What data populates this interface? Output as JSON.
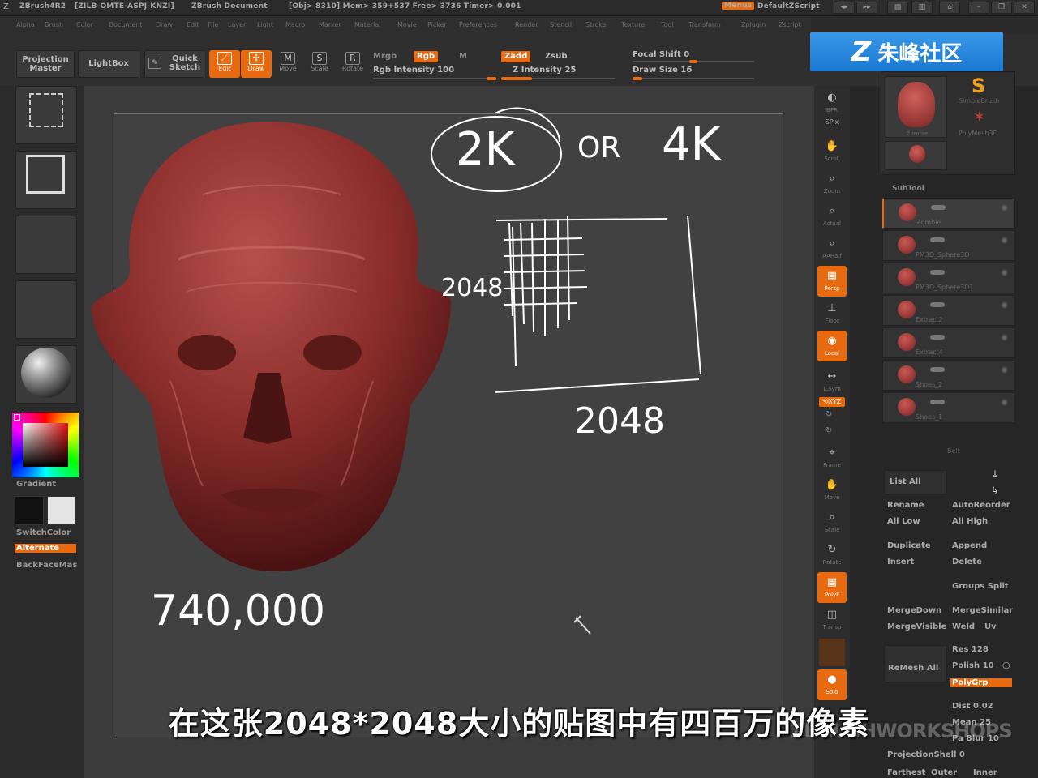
{
  "titlebar": {
    "app": "ZBrush4R2",
    "build": "[ZILB-OMTE-ASPJ-KNZI]",
    "doc": "ZBrush Document",
    "stats": "[Obj> 8310] Mem> 359+537  Free> 3736  Timer> 0.001",
    "menus_btn": "Menus",
    "script": "DefaultZScript"
  },
  "menubar": [
    "Alpha",
    "Brush",
    "Color",
    "Document",
    "Draw",
    "Edit",
    "File",
    "Layer",
    "Light",
    "Macro",
    "Marker",
    "Material",
    "Movie",
    "Picker",
    "Preferences",
    "Render",
    "Stencil",
    "Stroke",
    "Texture",
    "Tool",
    "Transform",
    "Zplugin",
    "Zscript"
  ],
  "shelf": {
    "projection_master": "Projection Master",
    "lightbox": "LightBox",
    "quick_sketch": "Quick Sketch",
    "edit": "Edit",
    "draw": "Draw",
    "move": "Move",
    "scale": "Scale",
    "rotate": "Rotate",
    "mrgb": "Mrgb",
    "rgb": "Rgb",
    "m": "M",
    "rgb_intensity": "Rgb Intensity 100",
    "zadd": "Zadd",
    "zsub": "Zsub",
    "z_intensity": "Z Intensity 25",
    "focal_shift": "Focal Shift 0",
    "draw_size": "Draw Size 16"
  },
  "logo": {
    "text": "朱峰社区",
    "glyph": "Z"
  },
  "leftpanel": {
    "gradient": "Gradient",
    "switchcolor": "SwitchColor",
    "alternate": "Alternate",
    "backface": "BackFaceMas"
  },
  "canvas": {
    "annotation_top_2k": "2K",
    "annotation_or": "OR",
    "annotation_4k": "4K",
    "annotation_side": "2048",
    "annotation_bottom": "2048",
    "annotation_count": "740,000"
  },
  "righttools": [
    {
      "label": "BPR",
      "icon": "◐",
      "active": false
    },
    {
      "label": "SPix",
      "icon": "▬",
      "active": false
    },
    {
      "label": "Scroll",
      "icon": "✋",
      "active": false
    },
    {
      "label": "Zoom",
      "icon": "⌕",
      "active": false
    },
    {
      "label": "Actual",
      "icon": "⌕",
      "active": false
    },
    {
      "label": "AAHalf",
      "icon": "⌕",
      "active": false
    },
    {
      "label": "Persp",
      "icon": "▦",
      "active": true
    },
    {
      "label": "Floor",
      "icon": "⊥",
      "active": false
    },
    {
      "label": "Local",
      "icon": "◉",
      "active": true
    },
    {
      "label": "L.Sym",
      "icon": "↔",
      "active": false
    },
    {
      "label": "Frame",
      "icon": "⌖",
      "active": false
    },
    {
      "label": "Move",
      "icon": "✋",
      "active": false
    },
    {
      "label": "Scale",
      "icon": "⌕",
      "active": false
    },
    {
      "label": "Rotate",
      "icon": "↻",
      "active": false
    },
    {
      "label": "PolyF",
      "icon": "▦",
      "active": true
    },
    {
      "label": "Transp",
      "icon": "◫",
      "active": false
    },
    {
      "label": "Ghost",
      "icon": "■",
      "active": false
    },
    {
      "label": "Solo",
      "icon": "●",
      "active": true
    }
  ],
  "rightpanel": {
    "tool_thumb_label": "Zombie",
    "simplebrush": "SimpleBrush",
    "polymesh": "PolyMesh3D",
    "subtool_title": "SubTool",
    "subtools": [
      "Zombie",
      "PM3D_Sphere3D",
      "PM3D_Sphere3D1",
      "Extract2",
      "Extract4",
      "Shoes_2",
      "Shoes_1"
    ],
    "last_sub": "Belt",
    "list_all": "List All",
    "rename": "Rename",
    "autoreorder": "AutoReorder",
    "all_low": "All Low",
    "all_high": "All High",
    "duplicate": "Duplicate",
    "append": "Append",
    "insert": "Insert",
    "delete": "Delete",
    "groups_split": "Groups Split",
    "mergedown": "MergeDown",
    "mergesimilar": "MergeSimilar",
    "mergevisible": "MergeVisible",
    "weld": "Weld",
    "uv": "Uv",
    "remesh_all": "ReMesh All",
    "res": "Res 128",
    "polish": "Polish 10",
    "polygrp": "PolyGrp",
    "dist": "Dist 0.02",
    "mean": "Mean 25",
    "pa_blur": "Pa Blur 10",
    "projectionshell": "ProjectionShell 0",
    "farthest": "Farthest",
    "outer": "Outer",
    "inner": "Inner"
  },
  "subtitle": "在这张2048*2048大小的贴图中有四百万的像素",
  "watermark": "ZBRUSHWORKSHOPS",
  "colors": {
    "accent": "#e86a10",
    "head": "#8a2d2a"
  }
}
